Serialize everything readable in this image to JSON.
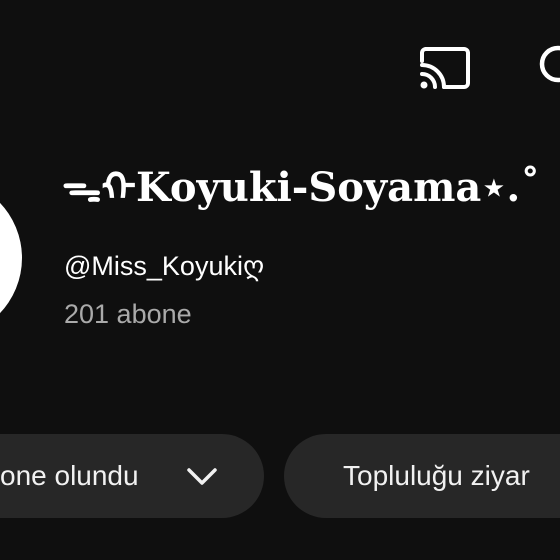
{
  "topbar": {
    "cast_icon": "cast-icon",
    "search_icon": "search-icon"
  },
  "channel": {
    "name": "ᯓᡣKoyuki-Soyama⋆.˚",
    "handle": "@Miss_Koyukiღ",
    "subscribers": "201 abone"
  },
  "actions": {
    "subscribed_label": "one olundu",
    "subscribed_icon": "chevron-down-icon",
    "community_label": "Topluluğu ziyar"
  },
  "colors": {
    "background": "#0f0f0f",
    "pill": "#272727",
    "secondary_text": "#aaaaaa"
  }
}
